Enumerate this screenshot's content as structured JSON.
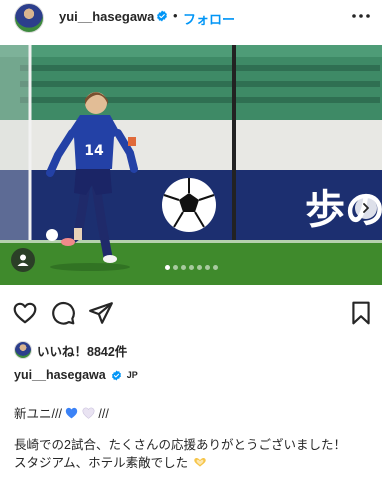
{
  "header": {
    "username": "yui__hasegawa",
    "separator": "•",
    "follow_label": "フォロー"
  },
  "post": {
    "image_alt": "Soccer player in blue kit dribbling the ball on a pitch",
    "carousel": {
      "count": 7,
      "active_index": 0
    },
    "banner_text": "歩の"
  },
  "likes": {
    "text": "いいね！8842件"
  },
  "caption": {
    "username": "yui__hasegawa",
    "country": "JP",
    "line1_text": "新ユニ///",
    "line1_tail": "///",
    "line2": "長崎での2試合、たくさんの応援ありがとうございました！",
    "line3": "スタジアム、ホテル素敵でした"
  },
  "colors": {
    "accent": "#0095f6",
    "text": "#262626",
    "heart_blue": "#3b82f6",
    "heart_white": "#e9e3f2"
  },
  "icons": [
    "verified-badge-icon",
    "more-options-icon",
    "next-arrow-icon",
    "user-tag-icon",
    "heart-icon",
    "comment-icon",
    "share-icon",
    "save-icon"
  ]
}
